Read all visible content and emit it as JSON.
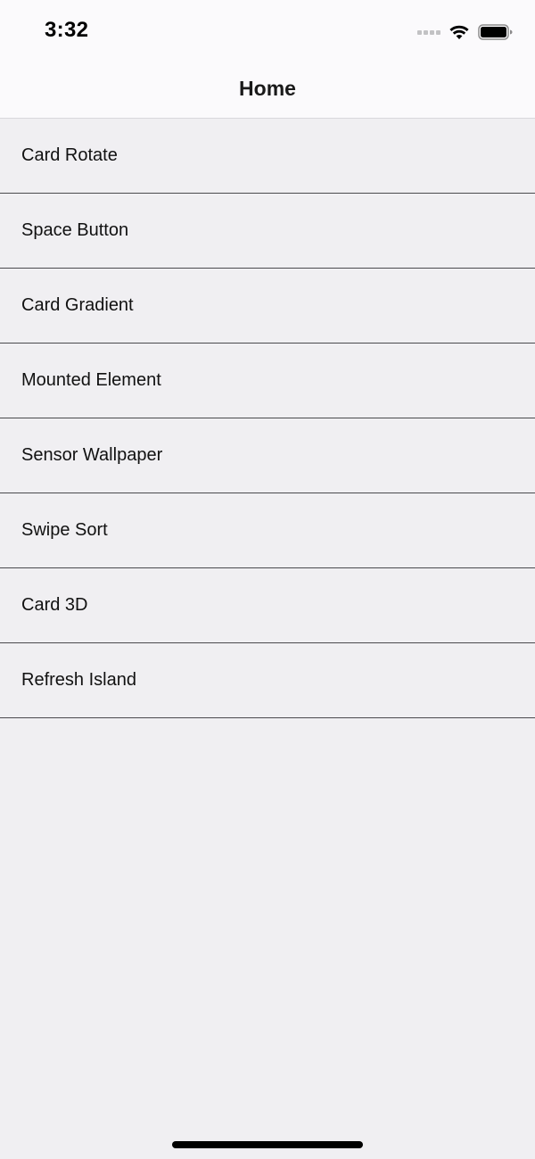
{
  "status_bar": {
    "time": "3:32",
    "icons": [
      "cellular-signal-icon",
      "wifi-icon",
      "battery-icon"
    ]
  },
  "nav": {
    "title": "Home"
  },
  "menu": {
    "items": [
      {
        "label": "Card Rotate"
      },
      {
        "label": "Space Button"
      },
      {
        "label": "Card Gradient"
      },
      {
        "label": "Mounted Element"
      },
      {
        "label": "Sensor Wallpaper"
      },
      {
        "label": "Swipe Sort"
      },
      {
        "label": "Card 3D"
      },
      {
        "label": "Refresh Island"
      }
    ]
  },
  "colors": {
    "background": "#f0eff2",
    "nav_background": "#fbfafc",
    "separator": "#4a4a4e",
    "text": "#111111"
  }
}
